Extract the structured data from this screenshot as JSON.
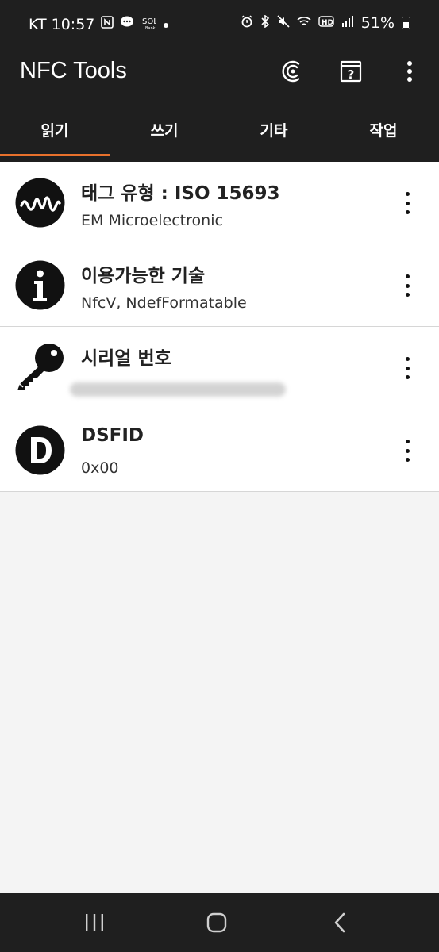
{
  "status": {
    "carrier_time": "KT 10:57",
    "battery": "51%",
    "left_icons": [
      "nfc-icon",
      "message-icon",
      "bank-app-icon",
      "dot-icon"
    ],
    "right_icons": [
      "alarm-icon",
      "bluetooth-icon",
      "mute-icon",
      "wifi-icon",
      "hd-icon",
      "signal-icon",
      "battery-icon"
    ]
  },
  "app": {
    "title": "NFC Tools",
    "actions": [
      "nfc-scan-icon",
      "help-icon",
      "more-vert-icon"
    ]
  },
  "tabs": [
    {
      "label": "읽기",
      "active": true
    },
    {
      "label": "쓰기",
      "active": false
    },
    {
      "label": "기타",
      "active": false
    },
    {
      "label": "작업",
      "active": false
    }
  ],
  "colors": {
    "bar": "#1f1f1f",
    "accent": "#e8712c"
  },
  "items": [
    {
      "title": "태그 유형 : ISO 15693",
      "subtitle": "EM Microelectronic",
      "icon": "waveform-icon"
    },
    {
      "title": "이용가능한 기술",
      "subtitle": "NfcV, NdefFormatable",
      "icon": "info-icon"
    },
    {
      "title": "시리얼 번호",
      "subtitle": "",
      "icon": "key-icon"
    },
    {
      "title": "DSFID",
      "subtitle": "0x00",
      "icon": "dsfid-d-icon"
    }
  ],
  "nav": [
    "recent-apps-icon",
    "home-icon",
    "back-icon"
  ]
}
